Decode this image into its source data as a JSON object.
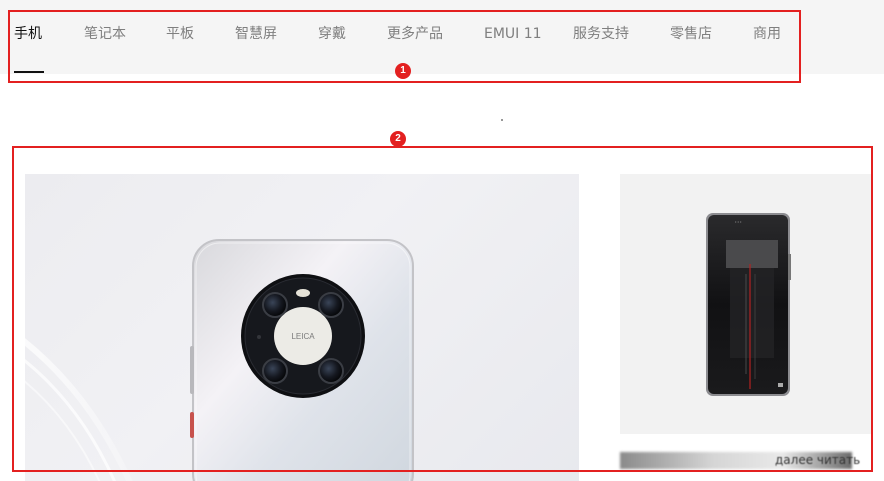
{
  "nav": {
    "items": [
      {
        "label": "手机",
        "active": true
      },
      {
        "label": "笔记本"
      },
      {
        "label": "平板"
      },
      {
        "label": "智慧屏"
      },
      {
        "label": "穿戴"
      },
      {
        "label": "更多产品"
      },
      {
        "label": "EMUI 11"
      },
      {
        "label": "服务支持"
      },
      {
        "label": "零售店"
      },
      {
        "label": "商用"
      }
    ]
  },
  "annotations": {
    "one": "1",
    "two": "2"
  },
  "main_product": {
    "camera_brand": "LEICA"
  },
  "side_product": {
    "caption": "далее читать"
  },
  "colors": {
    "annotation": "#e32020",
    "active_text": "#111111",
    "inactive_text": "#7f7f7f",
    "nav_background": "#f5f5f5"
  }
}
